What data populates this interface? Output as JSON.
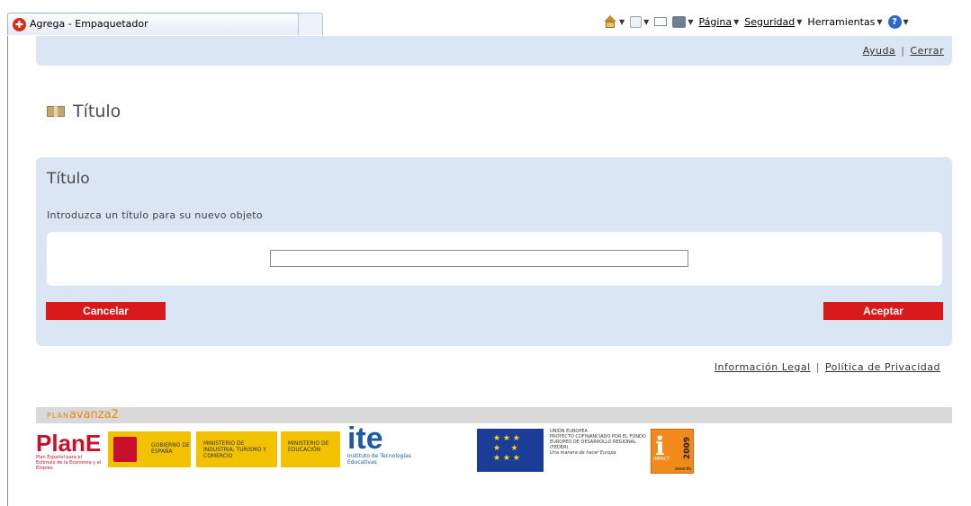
{
  "browser": {
    "tab_title": "Agrega - Empaquetador",
    "tools": {
      "page_label": "Página",
      "security_label": "Seguridad",
      "tools_label": "Herramientas"
    }
  },
  "header": {
    "help_link": "Ayuda",
    "close_link": "Cerrar",
    "separator": "|"
  },
  "page": {
    "title": "Título"
  },
  "form": {
    "title": "Título",
    "description": "Introduzca un título para su nuevo objeto",
    "input_value": "",
    "cancel_label": "Cancelar",
    "accept_label": "Aceptar"
  },
  "footer": {
    "legal_link": "Información Legal",
    "privacy_link": "Política de Privacidad",
    "separator": "|",
    "plan_avanza_prefix": "PLAN",
    "plan_avanza_name": "avanza2",
    "logos": {
      "plane": "PlanE",
      "plane_sub": "Plan Español para el Estímulo de la Economía y el Empleo",
      "gobierno": "GOBIERNO DE ESPAÑA",
      "min_industria": "MINISTERIO DE INDUSTRIA, TURISMO Y COMERCIO",
      "min_educacion": "MINISTERIO DE EDUCACIÓN",
      "ite": "ite",
      "ite_sub": "Instituto de Tecnologías Educativas",
      "eu_title": "UNIÓN EUROPEA",
      "eu_text": "PROYECTO COFINANCIADO POR EL FONDO EUROPEO DE DESARROLLO REGIONAL (FEDER)",
      "eu_motto": "Una manera de hacer Europa",
      "impact_year": "2009",
      "impact_awards": "awards",
      "impact_tag": "IMPACT"
    }
  }
}
